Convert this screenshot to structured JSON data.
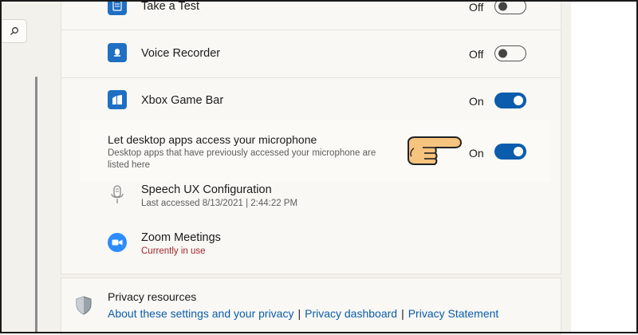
{
  "search": {
    "icon": "search-icon"
  },
  "apps": [
    {
      "name": "Take a Test",
      "state": "Off",
      "icon": "take-a-test-icon"
    },
    {
      "name": "Voice Recorder",
      "state": "Off",
      "icon": "voice-recorder-icon"
    },
    {
      "name": "Xbox Game Bar",
      "state": "On",
      "icon": "xbox-game-bar-icon"
    }
  ],
  "desktop_apps": {
    "title": "Let desktop apps access your microphone",
    "description": "Desktop apps that have previously accessed your microphone are listed here",
    "state": "On",
    "pointer_icon": "pointing-hand-icon"
  },
  "desktop_list": [
    {
      "name": "Speech UX Configuration",
      "detail": "Last accessed 8/13/2021  |  2:44:22 PM",
      "icon": "microphone-icon"
    },
    {
      "name": "Zoom Meetings",
      "detail": "Currently in use",
      "icon": "zoom-icon"
    }
  ],
  "privacy": {
    "title": "Privacy resources",
    "links": [
      "About these settings and your privacy",
      "Privacy dashboard",
      "Privacy Statement"
    ],
    "separator": "|",
    "icon": "shield-icon"
  },
  "colors": {
    "accent": "#0b5cad",
    "in_use": "#a4262c"
  }
}
